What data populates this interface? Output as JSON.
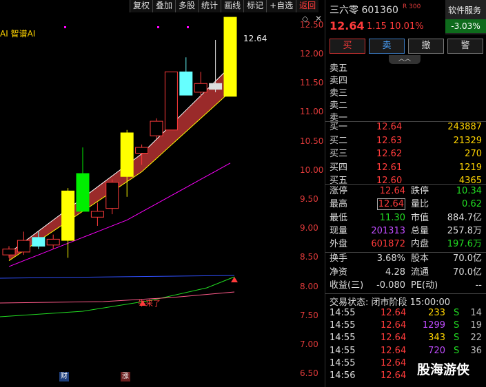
{
  "toolbar": [
    "复权",
    "叠加",
    "多股",
    "统计",
    "画线",
    "标记",
    "+自选",
    "返回"
  ],
  "indicator_label": "AI 智谱AI",
  "last_price_label": "12.64",
  "signal_text": "牛来了",
  "markers": {
    "fin": "财",
    "up": "涨"
  },
  "watermark": "股海游侠",
  "colors": {
    "up": "#ff3b3b",
    "down": "#22dd22",
    "yellow": "#ffff00",
    "cyan": "#66ffff",
    "band": "#9a2a2a"
  },
  "chart_data": {
    "type": "candlestick",
    "ylim": [
      6.3,
      12.7
    ],
    "y_ticks": [
      "12.50",
      "12.00",
      "11.50",
      "11.00",
      "10.50",
      "10.00",
      "9.50",
      "9.00",
      "8.50",
      "8.00",
      "7.50",
      "7.00",
      "6.50"
    ],
    "candles": [
      {
        "o": 8.55,
        "h": 8.7,
        "l": 8.5,
        "c": 8.65,
        "color": "red"
      },
      {
        "o": 8.6,
        "h": 8.95,
        "l": 8.55,
        "c": 8.8,
        "color": "red"
      },
      {
        "o": 8.7,
        "h": 8.95,
        "l": 8.65,
        "c": 8.85,
        "color": "cyan"
      },
      {
        "o": 8.72,
        "h": 8.9,
        "l": 8.65,
        "c": 8.82,
        "color": "red"
      },
      {
        "o": 8.8,
        "h": 9.7,
        "l": 8.5,
        "c": 9.65,
        "color": "yellow"
      },
      {
        "o": 9.95,
        "h": 10.4,
        "l": 9.3,
        "c": 9.3,
        "color": "green"
      },
      {
        "o": 9.3,
        "h": 9.45,
        "l": 9.05,
        "c": 9.2,
        "color": "red"
      },
      {
        "o": 9.35,
        "h": 9.85,
        "l": 9.25,
        "c": 9.8,
        "color": "red"
      },
      {
        "o": 9.9,
        "h": 10.7,
        "l": 9.55,
        "c": 10.65,
        "color": "yellow"
      },
      {
        "o": 10.3,
        "h": 10.45,
        "l": 10.1,
        "c": 10.4,
        "color": "red"
      },
      {
        "o": 10.6,
        "h": 10.9,
        "l": 10.55,
        "c": 10.85,
        "color": "red"
      },
      {
        "o": 10.7,
        "h": 11.7,
        "l": 10.7,
        "c": 11.7,
        "color": "red"
      },
      {
        "o": 11.7,
        "h": 11.95,
        "l": 11.3,
        "c": 11.3,
        "color": "cyan"
      },
      {
        "o": 11.35,
        "h": 11.7,
        "l": 11.25,
        "c": 11.5,
        "color": "red"
      },
      {
        "o": 11.4,
        "h": 12.25,
        "l": 11.35,
        "c": 11.5,
        "color": "white"
      },
      {
        "o": 11.28,
        "h": 12.64,
        "l": 11.28,
        "c": 12.64,
        "color": "yellow"
      }
    ]
  },
  "quote": {
    "title": "三六零 601360",
    "badge": "R 300",
    "service_label": "软件服务",
    "service_change": "-3.03%",
    "price": "12.64",
    "change": "1.15",
    "pct": "10.01%",
    "btn_buy": "买",
    "btn_sell": "卖",
    "btn_cancel": "撤",
    "btn_alert": "警",
    "collapse_icon": "︿︿"
  },
  "asks": [
    {
      "label": "卖五",
      "price": "",
      "vol": ""
    },
    {
      "label": "卖四",
      "price": "",
      "vol": ""
    },
    {
      "label": "卖三",
      "price": "",
      "vol": ""
    },
    {
      "label": "卖二",
      "price": "",
      "vol": ""
    },
    {
      "label": "卖一",
      "price": "",
      "vol": ""
    }
  ],
  "bids": [
    {
      "label": "买一",
      "price": "12.64",
      "vol": "243887"
    },
    {
      "label": "买二",
      "price": "12.63",
      "vol": "21329"
    },
    {
      "label": "买三",
      "price": "12.62",
      "vol": "270"
    },
    {
      "label": "买四",
      "price": "12.61",
      "vol": "1219"
    },
    {
      "label": "买五",
      "price": "12.60",
      "vol": "4365"
    }
  ],
  "stats": [
    {
      "k1": "涨停",
      "v1": "12.64",
      "c1": "red",
      "k2": "跌停",
      "v2": "10.34",
      "c2": "green"
    },
    {
      "k1": "最高",
      "v1": "12.64",
      "c1": "red",
      "k2": "量比",
      "v2": "0.62",
      "c2": "green"
    },
    {
      "k1": "最低",
      "v1": "11.30",
      "c1": "green",
      "k2": "市值",
      "v2": "884.7亿",
      "c2": "white"
    },
    {
      "k1": "现量",
      "v1": "201313",
      "c1": "purple",
      "k2": "总量",
      "v2": "257.8万",
      "c2": "white"
    },
    {
      "k1": "外盘",
      "v1": "601872",
      "c1": "red",
      "k2": "内盘",
      "v2": "197.6万",
      "c2": "green"
    }
  ],
  "fundamentals": [
    {
      "k1": "换手",
      "v1": "3.68%",
      "k2": "股本",
      "v2": "70.0亿"
    },
    {
      "k1": "净资",
      "v1": "4.28",
      "k2": "流通",
      "v2": "70.0亿"
    },
    {
      "k1": "收益(三)",
      "v1": "-0.080",
      "k2": "PE(动)",
      "v2": "--"
    }
  ],
  "trade_status": "交易状态: 闭市阶段 15:00:00",
  "ticks": [
    {
      "time": "14:55",
      "price": "12.64",
      "vol": "233",
      "vc": "yellow",
      "side": "S",
      "cnt": "14"
    },
    {
      "time": "14:55",
      "price": "12.64",
      "vol": "1299",
      "vc": "purple",
      "side": "S",
      "cnt": "19"
    },
    {
      "time": "14:55",
      "price": "12.64",
      "vol": "343",
      "vc": "yellow",
      "side": "S",
      "cnt": "22"
    },
    {
      "time": "14:55",
      "price": "12.64",
      "vol": "720",
      "vc": "purple",
      "side": "S",
      "cnt": "36"
    },
    {
      "time": "14:55",
      "price": "12.64",
      "vol": "",
      "vc": "yellow",
      "side": "",
      "cnt": ""
    },
    {
      "time": "14:56",
      "price": "12.64",
      "vol": "",
      "vc": "yellow",
      "side": "",
      "cnt": ""
    }
  ]
}
